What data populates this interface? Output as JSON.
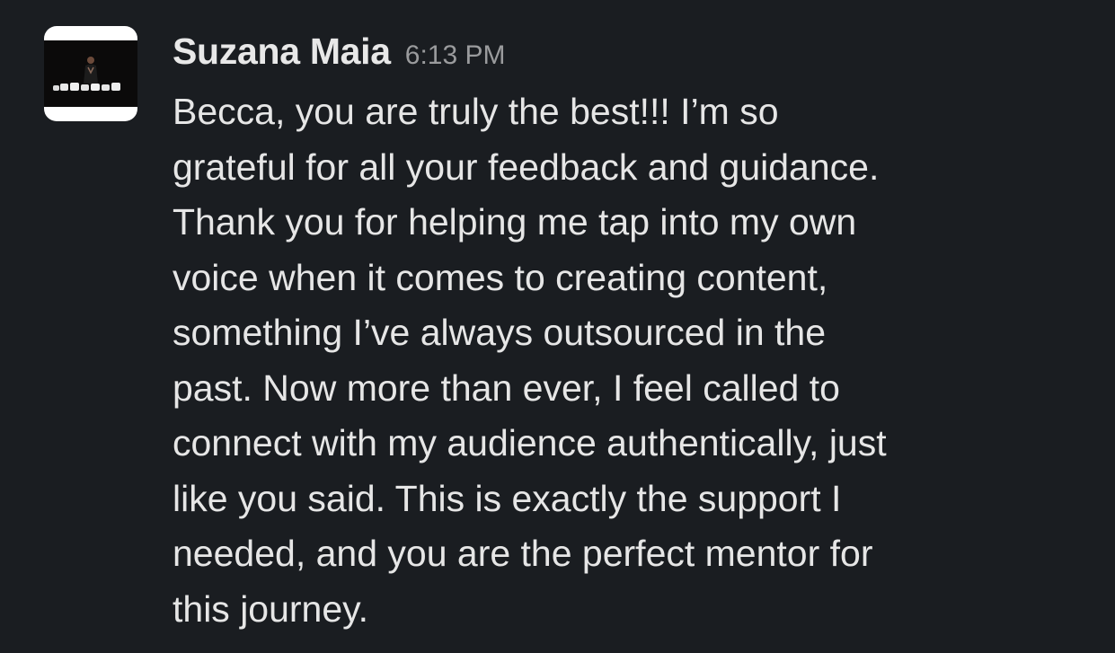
{
  "message": {
    "sender": "Suzana Maia",
    "timestamp": "6:13 PM",
    "avatar_icon": "profile-photo",
    "lines": [
      "Becca, you are truly the best!!! I’m so",
      "grateful for all your feedback and guidance.",
      "Thank you for helping me tap into my own",
      "voice when it comes to creating content,",
      "something I’ve always outsourced in the",
      "past. Now more than ever, I feel called to",
      "connect with my audience authentically, just",
      "like you said. This is exactly the support I",
      "needed, and you are the perfect mentor for",
      "this journey."
    ]
  },
  "colors": {
    "background": "#1a1d21",
    "sender": "#e8e8e8",
    "timestamp": "#9a9b9d",
    "text": "#e6e6e6"
  }
}
